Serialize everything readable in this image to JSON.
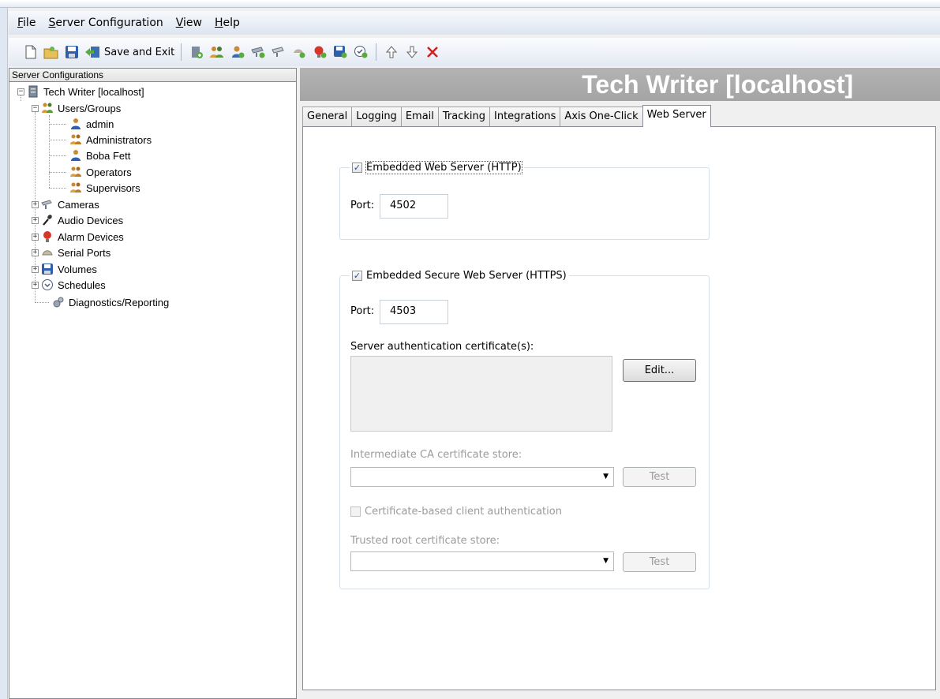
{
  "menu": {
    "file": "File",
    "server_configuration": "Server Configuration",
    "view": "View",
    "help": "Help"
  },
  "toolbar": {
    "save_and_exit": "Save and Exit"
  },
  "tree": {
    "header": "Server Configurations",
    "root": "Tech Writer [localhost]",
    "users_groups": "Users/Groups",
    "users": [
      "admin",
      "Administrators",
      "Boba Fett",
      "Operators",
      "Supervisors"
    ],
    "cameras": "Cameras",
    "audio_devices": "Audio Devices",
    "alarm_devices": "Alarm Devices",
    "serial_ports": "Serial Ports",
    "volumes": "Volumes",
    "schedules": "Schedules",
    "diagnostics": "Diagnostics/Reporting"
  },
  "banner": {
    "title": "Tech Writer [localhost]"
  },
  "tabs": [
    "General",
    "Logging",
    "Email",
    "Tracking",
    "Integrations",
    "Axis One-Click",
    "Web Server"
  ],
  "web_server": {
    "http": {
      "label": "Embedded Web Server (HTTP)",
      "checked": true,
      "port_label": "Port:",
      "port": "4502"
    },
    "https": {
      "label": "Embedded Secure Web Server (HTTPS)",
      "checked": true,
      "port_label": "Port:",
      "port": "4503",
      "cert_label": "Server authentication certificate(s):",
      "edit_button": "Edit...",
      "intermediate_label": "Intermediate CA certificate store:",
      "intermediate_value": "",
      "test_button": "Test",
      "client_auth_label": "Certificate-based client authentication",
      "client_auth_checked": false,
      "trusted_root_label": "Trusted root certificate store:",
      "trusted_root_value": "",
      "test_button_2": "Test"
    }
  },
  "colors": {
    "banner_bg": "#a9a9a9",
    "checkmark": "#254e8f",
    "delete_icon": "#d32020"
  }
}
